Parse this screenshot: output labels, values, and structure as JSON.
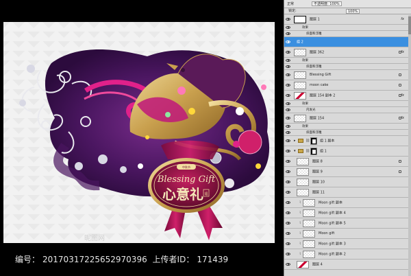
{
  "panel": {
    "tab_label": "正常",
    "opacity_label": "不透明度: 100%",
    "lock_label": "锁定:",
    "fill_label": "100%",
    "layers": [
      {
        "id": "l1",
        "type": "layer",
        "name": "图层 1",
        "thumb": "white-border",
        "fx": "fx",
        "eye": true
      },
      {
        "id": "l2",
        "type": "effects",
        "name": "效果",
        "eye": true
      },
      {
        "id": "l3",
        "type": "effect",
        "name": "斜面和浮雕",
        "eye": true
      },
      {
        "id": "l4",
        "type": "layer",
        "name": "组 2",
        "thumb": "none",
        "eye": true,
        "selected": true
      },
      {
        "id": "l5",
        "type": "layer",
        "name": "图层 362",
        "thumb": "checker",
        "fx": "fx",
        "eye": true,
        "lock": true
      },
      {
        "id": "l6",
        "type": "effects",
        "name": "效果",
        "eye": true
      },
      {
        "id": "l7",
        "type": "effect",
        "name": "斜面和浮雕",
        "eye": true
      },
      {
        "id": "l8",
        "type": "layer",
        "name": "Blessing Gift",
        "thumb": "checker",
        "eye": true,
        "lock": true
      },
      {
        "id": "l9",
        "type": "layer",
        "name": "moon cake",
        "thumb": "checker",
        "eye": true,
        "lock": true
      },
      {
        "id": "l10",
        "type": "layer",
        "name": "图层 154 副本 2",
        "thumb": "red",
        "fx": "fx",
        "eye": true,
        "lock": true
      },
      {
        "id": "l11",
        "type": "effects",
        "name": "效果",
        "eye": true
      },
      {
        "id": "l12",
        "type": "effect",
        "name": "内发光",
        "eye": true
      },
      {
        "id": "l13",
        "type": "layer",
        "name": "图层 154",
        "thumb": "checker",
        "fx": "fx",
        "eye": true,
        "lock": true
      },
      {
        "id": "l14",
        "type": "effects",
        "name": "效果",
        "eye": true
      },
      {
        "id": "l15",
        "type": "effect",
        "name": "斜面和浮雕",
        "eye": true
      },
      {
        "id": "l16",
        "type": "group",
        "name": "组 1 副本",
        "eye": true,
        "expanded": false
      },
      {
        "id": "l17",
        "type": "group",
        "name": "组 1",
        "eye": true,
        "expanded": true
      },
      {
        "id": "l18",
        "type": "layer",
        "name": "图层 8",
        "thumb": "checker",
        "eye": true,
        "lock": true,
        "indent": 1
      },
      {
        "id": "l19",
        "type": "layer",
        "name": "图层 9",
        "thumb": "checker",
        "eye": true,
        "lock": true,
        "indent": 1
      },
      {
        "id": "l20",
        "type": "layer",
        "name": "图层 10",
        "thumb": "checker",
        "eye": true,
        "indent": 1
      },
      {
        "id": "l21",
        "type": "layer",
        "name": "图层 11",
        "thumb": "checker",
        "eye": true,
        "indent": 1
      },
      {
        "id": "l22",
        "type": "layer",
        "name": "Moon gift 副本",
        "thumb": "checker",
        "eye": true,
        "indent": 2
      },
      {
        "id": "l23",
        "type": "layer",
        "name": "Moon gift 副本 4",
        "thumb": "checker",
        "eye": true,
        "indent": 2
      },
      {
        "id": "l24",
        "type": "layer",
        "name": "Moon gift 副本 5",
        "thumb": "checker",
        "eye": true,
        "indent": 2
      },
      {
        "id": "l25",
        "type": "layer",
        "name": "Moon gift",
        "thumb": "checker",
        "eye": true,
        "indent": 2
      },
      {
        "id": "l26",
        "type": "layer",
        "name": "Moon gift 副本 3",
        "thumb": "checker",
        "eye": true,
        "indent": 2
      },
      {
        "id": "l27",
        "type": "layer",
        "name": "Moon gift 副本 2",
        "thumb": "checker",
        "eye": true,
        "indent": 2
      },
      {
        "id": "l28",
        "type": "layer",
        "name": "图层 4",
        "thumb": "red",
        "eye": true,
        "indent": 1
      }
    ]
  },
  "artwork": {
    "badge_title_en": "Blessing Gift",
    "badge_title_cn": "心意礼",
    "badge_top": "中秋节",
    "badge_seal": "福",
    "watermark": "昵图网",
    "colors": {
      "purple": "#5b1f6b",
      "magenta": "#c0187a",
      "gold": "#d4b26a",
      "badge": "#8a0f3e"
    }
  },
  "caption": {
    "id_label": "编号：",
    "id_value": "20170317225652970396",
    "uploader_label": "上传者ID：",
    "uploader_value": "171439"
  }
}
